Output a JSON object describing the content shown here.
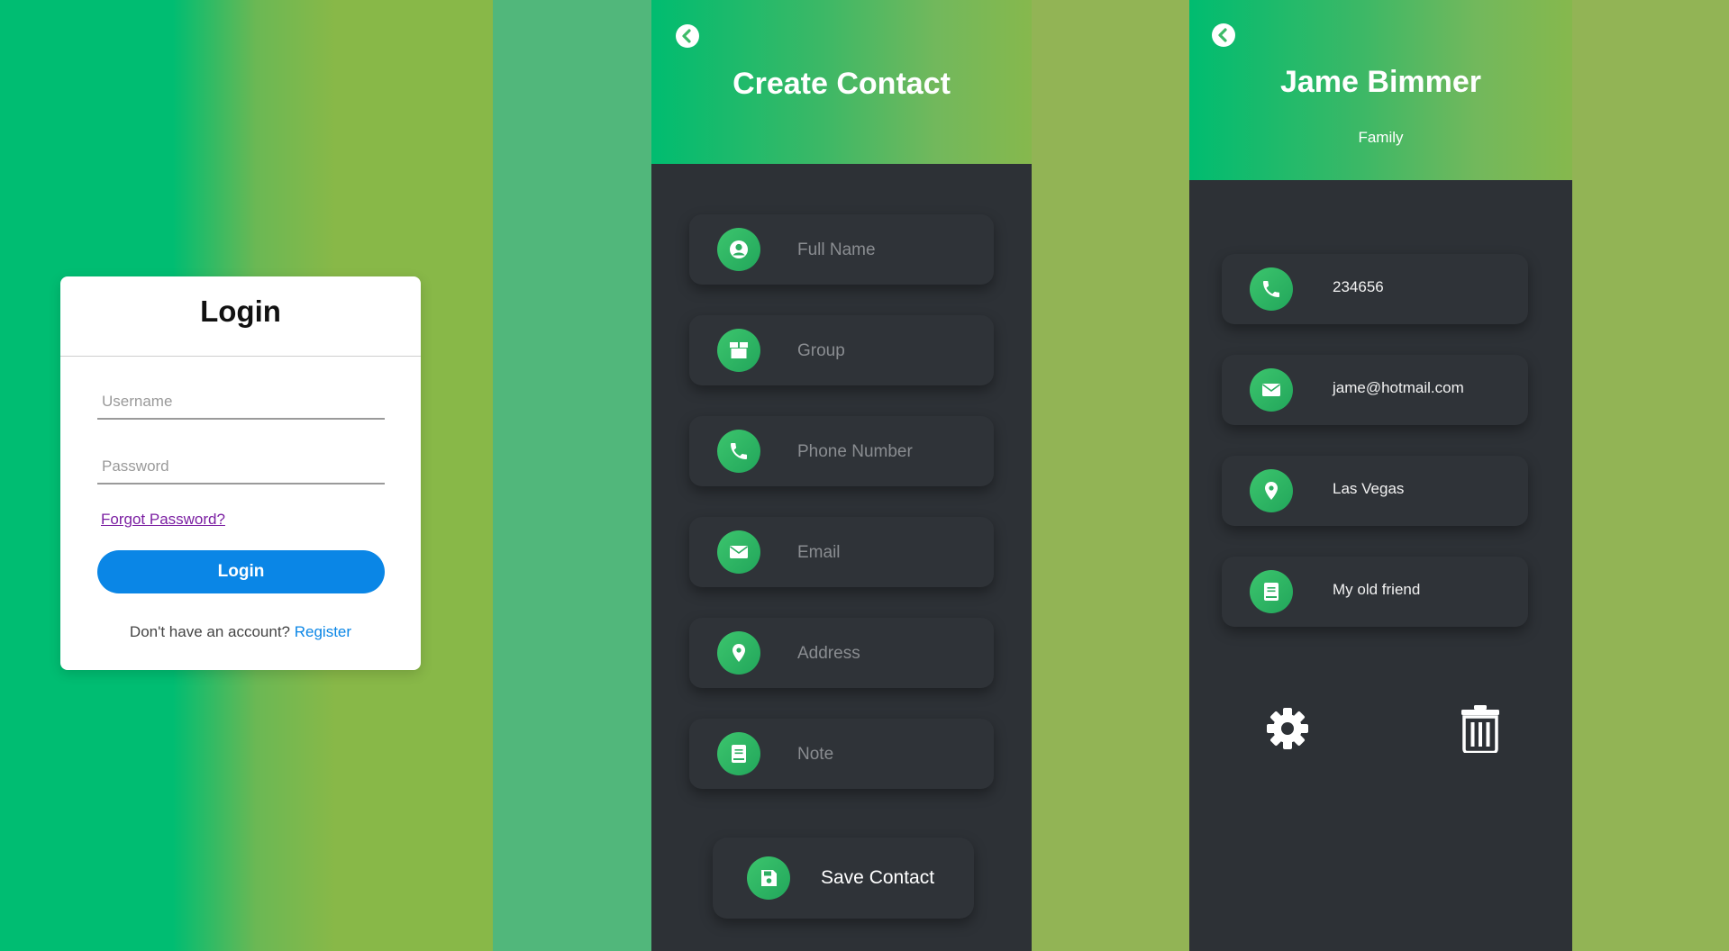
{
  "login": {
    "title": "Login",
    "username_placeholder": "Username",
    "password_placeholder": "Password",
    "forgot_label": "Forgot Password?",
    "button_label": "Login",
    "register_prompt": "Don't have an account?",
    "register_link": "Register"
  },
  "create_contact": {
    "back_icon": "chevron-left-icon",
    "title": "Create Contact",
    "fields": [
      {
        "icon": "user-circle-icon",
        "placeholder": "Full Name"
      },
      {
        "icon": "box-icon",
        "placeholder": "Group"
      },
      {
        "icon": "phone-icon",
        "placeholder": "Phone Number"
      },
      {
        "icon": "envelope-icon",
        "placeholder": "Email"
      },
      {
        "icon": "map-pin-icon",
        "placeholder": "Address"
      },
      {
        "icon": "book-icon",
        "placeholder": "Note"
      }
    ],
    "save_icon": "floppy-disk-icon",
    "save_label": "Save Contact"
  },
  "contact_detail": {
    "back_icon": "chevron-left-icon",
    "name": "Jame Bimmer",
    "group": "Family",
    "rows": [
      {
        "icon": "phone-icon",
        "value": "234656"
      },
      {
        "icon": "envelope-icon",
        "value": "jame@hotmail.com"
      },
      {
        "icon": "map-pin-icon",
        "value": "Las Vegas"
      },
      {
        "icon": "book-icon",
        "value": "My old friend"
      }
    ],
    "actions": {
      "edit_icon": "gear-icon",
      "delete_icon": "trash-icon"
    }
  },
  "colors": {
    "accent_green": "#22b95f",
    "panel_dark": "#2d3136",
    "login_blue": "#0a86e6"
  }
}
